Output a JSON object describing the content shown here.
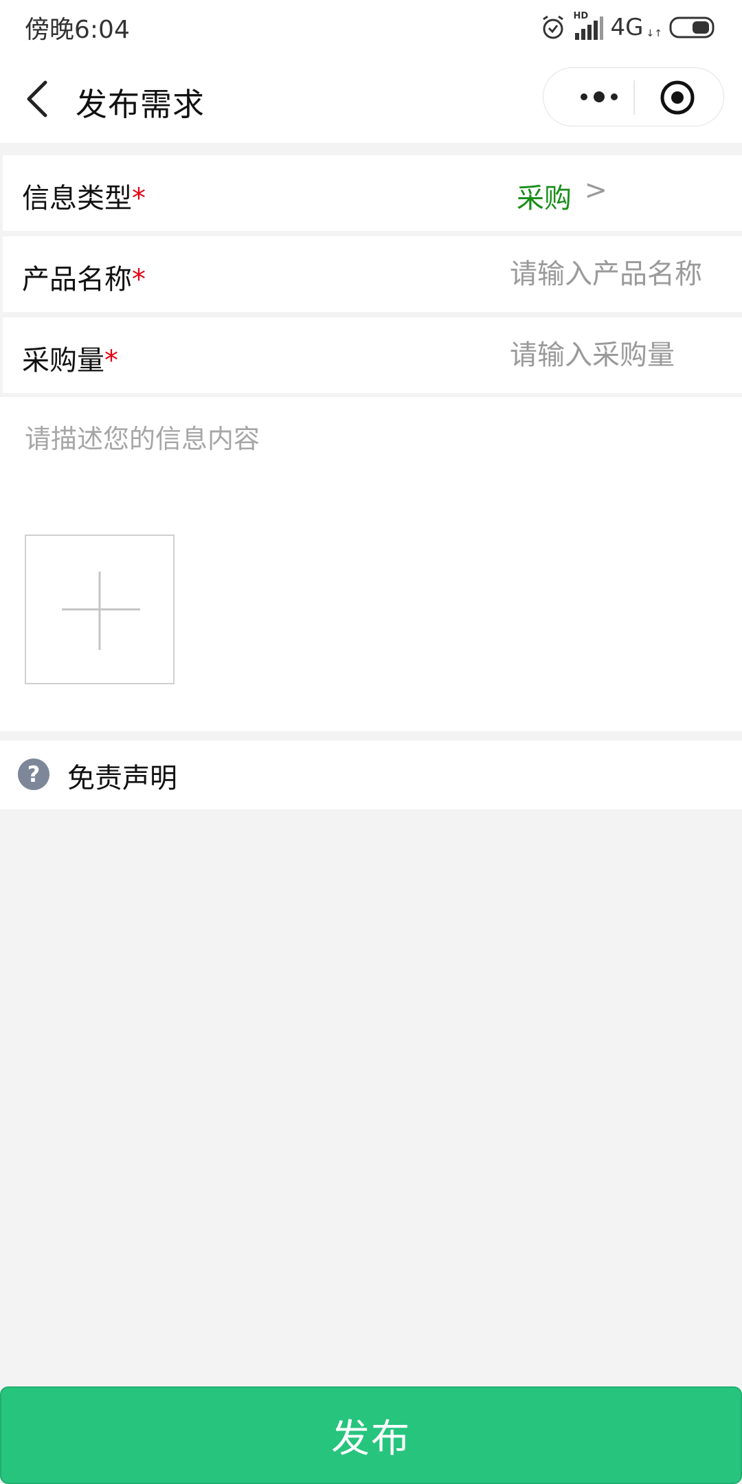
{
  "status_bar": {
    "time": "傍晚6:04",
    "network": "4G",
    "network_sub": "↓↑",
    "signal_label": "HD",
    "icons": [
      "alarm-icon",
      "signal-icon",
      "battery-icon"
    ]
  },
  "nav": {
    "title": "发布需求",
    "icons": [
      "back-arrow-icon",
      "more-dots-icon",
      "close-circle-icon"
    ]
  },
  "form": {
    "info_type": {
      "label": "信息类型",
      "required_mark": "*",
      "value": "采购",
      "chevron": ">"
    },
    "product_name": {
      "label": "产品名称",
      "required_mark": "*",
      "value": "",
      "placeholder": "请输入产品名称"
    },
    "purchase_qty": {
      "label": "采购量",
      "required_mark": "*",
      "value": "",
      "placeholder": "请输入采购量"
    },
    "description": {
      "value": "",
      "placeholder": "请描述您的信息内容"
    },
    "upload_icon": "plus-icon"
  },
  "disclaimer": {
    "icon_glyph": "?",
    "label": "免责声明"
  },
  "publish_button": {
    "label": "发布"
  },
  "colors": {
    "accent_green": "#27c47e",
    "value_green": "#1a8f1a",
    "required_red": "#e60012",
    "background": "#f3f3f3"
  }
}
